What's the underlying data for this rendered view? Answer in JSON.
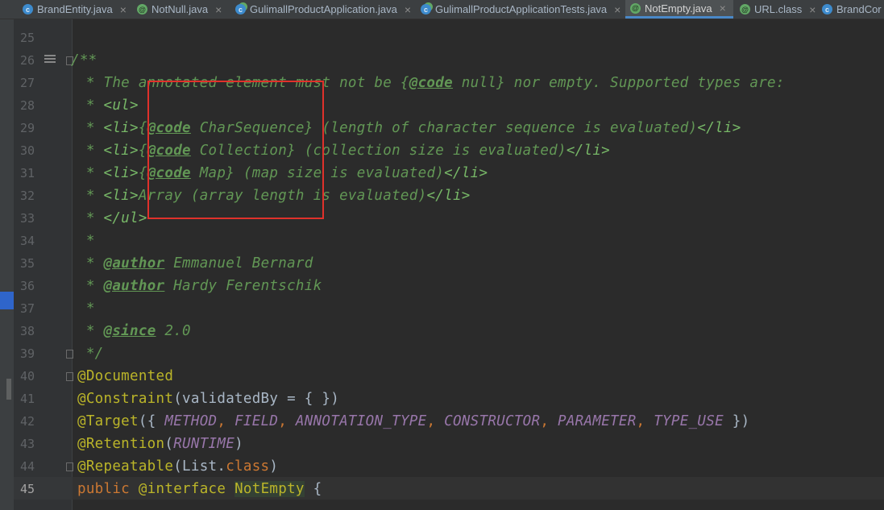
{
  "tabs": [
    {
      "label": "BrandEntity.java",
      "icon": "c"
    },
    {
      "label": "NotNull.java",
      "icon": "a"
    },
    {
      "label": "GulimallProductApplication.java",
      "icon": "s"
    },
    {
      "label": "GulimallProductApplicationTests.java",
      "icon": "s"
    },
    {
      "label": "NotEmpty.java",
      "icon": "a",
      "active": true
    },
    {
      "label": "URL.class",
      "icon": "a"
    },
    {
      "label": "BrandCor",
      "icon": "c"
    }
  ],
  "tab_close": "×",
  "line_numbers": [
    "25",
    "26",
    "27",
    "28",
    "29",
    "30",
    "31",
    "32",
    "33",
    "34",
    "35",
    "36",
    "37",
    "38",
    "39",
    "40",
    "41",
    "42",
    "43",
    "44",
    "45"
  ],
  "code": {
    "l26": "/**",
    "l27_a": " * The annotated element must not be {",
    "l27_b": "@code",
    "l27_c": " null} nor empty. Supported types are:",
    "l28_a": " * ",
    "l28_b": "<ul>",
    "l29_a": " * ",
    "l29_b": "<li>",
    "l29_c": "{",
    "l29_d": "@code",
    "l29_e": " CharSequence} (length of character sequence is evaluated)",
    "l29_f": "</li>",
    "l30_a": " * ",
    "l30_b": "<li>",
    "l30_c": "{",
    "l30_d": "@code",
    "l30_e": " Collection} (collection size is evaluated)",
    "l30_f": "</li>",
    "l31_a": " * ",
    "l31_b": "<li>",
    "l31_c": "{",
    "l31_d": "@code",
    "l31_e": " Map} (map size is evaluated)",
    "l31_f": "</li>",
    "l32_a": " * ",
    "l32_b": "<li>",
    "l32_c": "Array (array length is evaluated)",
    "l32_d": "</li>",
    "l33_a": " * ",
    "l33_b": "</ul>",
    "l34": " *",
    "l35_a": " * ",
    "l35_b": "@author",
    "l35_c": " Emmanuel Bernard",
    "l36_a": " * ",
    "l36_b": "@author",
    "l36_c": " Hardy Ferentschik",
    "l37": " *",
    "l38_a": " * ",
    "l38_b": "@since",
    "l38_c": " 2.0",
    "l39": " */",
    "l40": "@Documented",
    "l41_a": "@Constraint",
    "l41_b": "(validatedBy = { })",
    "l42_a": "@Target",
    "l42_b": "({ ",
    "l42_c1": "METHOD",
    "l42_c2": "FIELD",
    "l42_c3": "ANNOTATION_TYPE",
    "l42_c4": "CONSTRUCTOR",
    "l42_c5": "PARAMETER",
    "l42_c6": "TYPE_USE",
    "comma": ", ",
    "l42_d": " })",
    "l43_a": "@Retention",
    "l43_b": "(",
    "l43_c": "RUNTIME",
    "l43_d": ")",
    "l44_a": "@Repeatable",
    "l44_b": "(List.",
    "l44_c": "class",
    "l44_d": ")",
    "l45_a": "public ",
    "l45_b": "@interface ",
    "l45_c": "NotEmpty",
    "l45_d": " {"
  },
  "colors": {
    "background": "#2b2b2b",
    "comment": "#629755",
    "annotation": "#bbb529",
    "keyword": "#cc7832",
    "constant": "#9876aa",
    "highlight_box": "#e0312b"
  }
}
